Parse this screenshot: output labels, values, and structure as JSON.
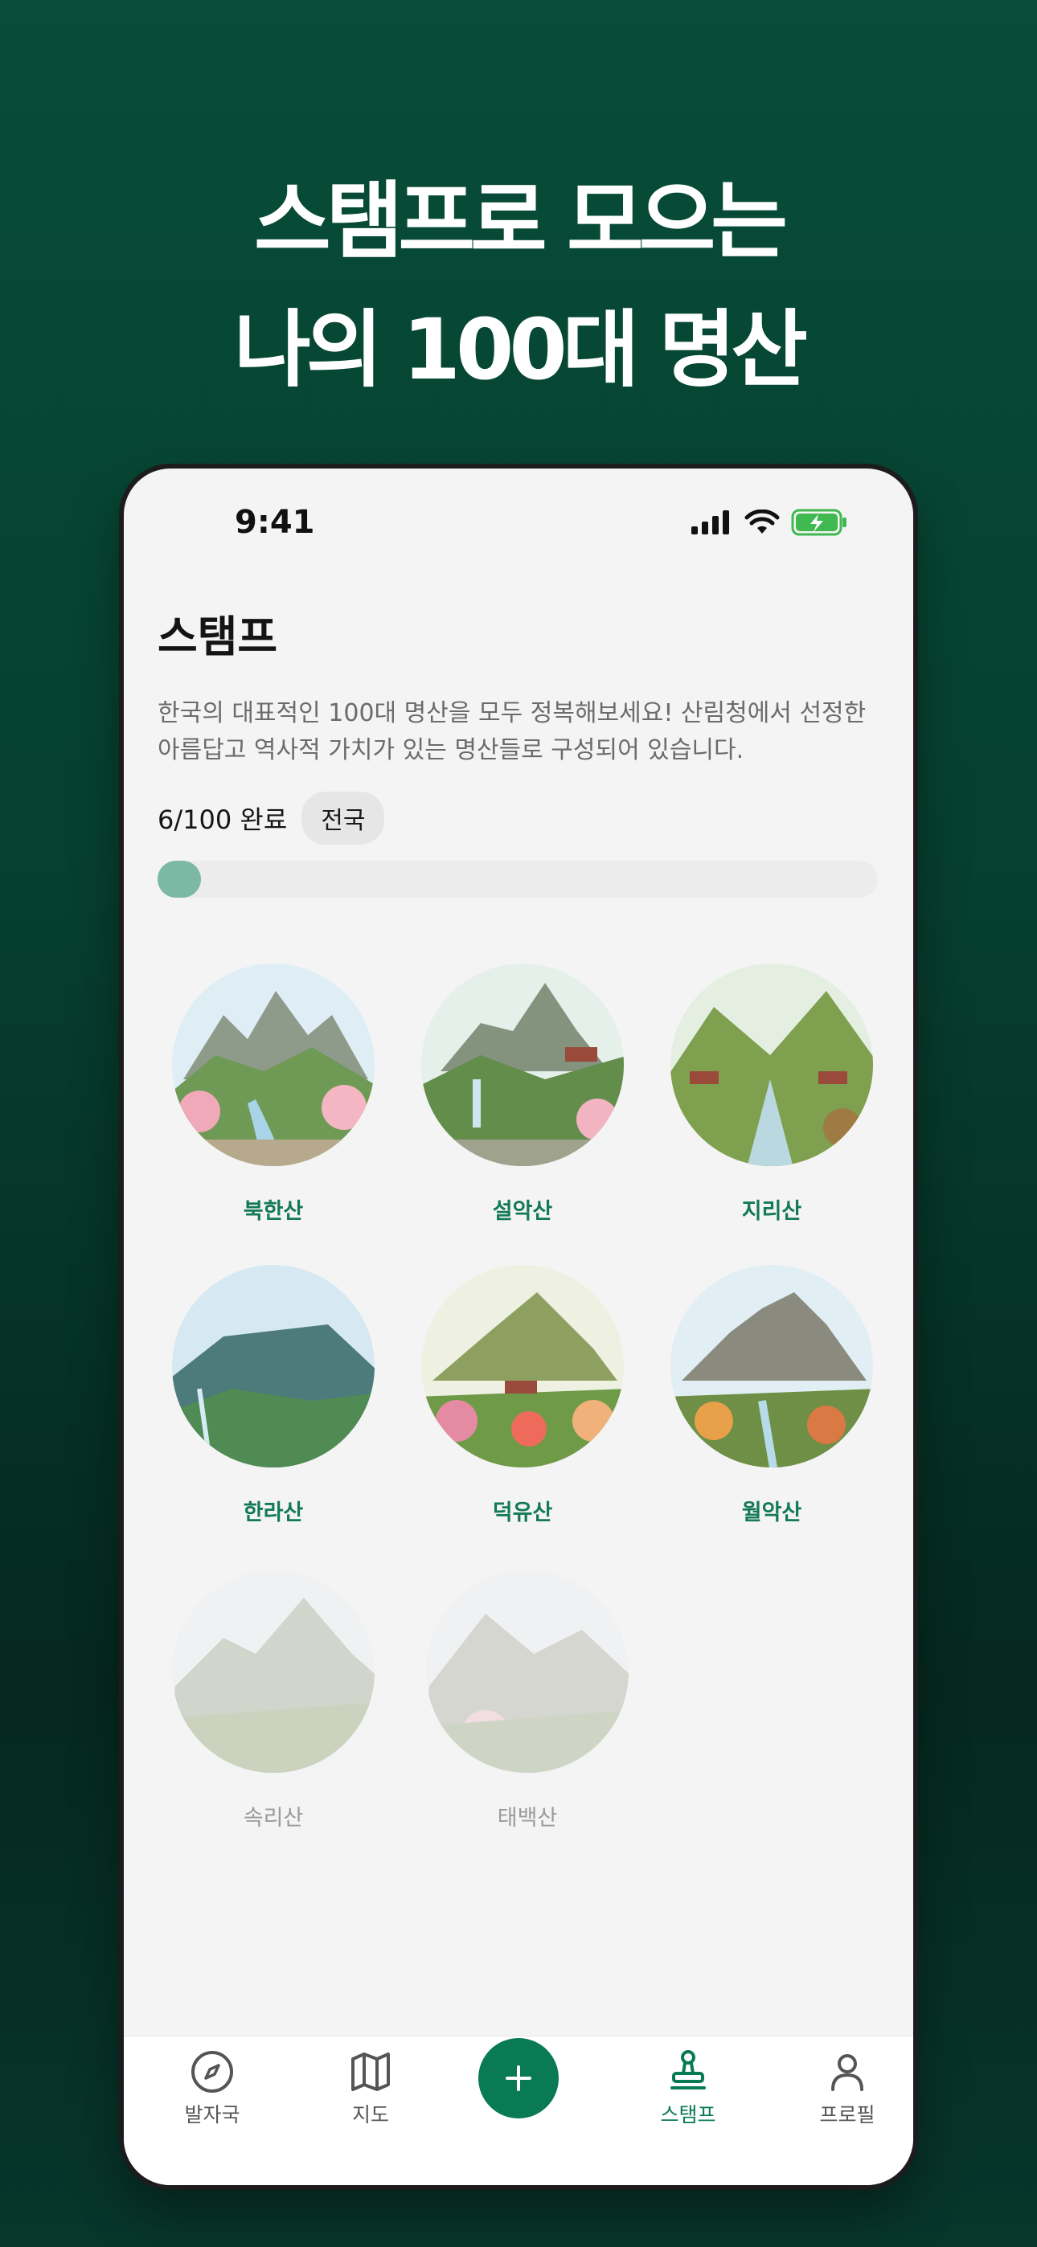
{
  "headline": {
    "line1": "스탬프로 모으는",
    "line2": "나의 100대 명산"
  },
  "status_bar": {
    "time": "9:41",
    "icons": [
      "signal-icon",
      "wifi-icon",
      "battery-charging-icon"
    ]
  },
  "page": {
    "title": "스탬프",
    "description": "한국의 대표적인 100대 명산을 모두 정복해보세요! 산림청에서 선정한 아름답고 역사적 가치가 있는 명산들로 구성되어 있습니다.",
    "progress_text": "6/100 완료",
    "region_filter": "전국",
    "progress_fraction": 0.06
  },
  "stamps": [
    {
      "name": "북한산",
      "collected": true
    },
    {
      "name": "설악산",
      "collected": true
    },
    {
      "name": "지리산",
      "collected": true
    },
    {
      "name": "한라산",
      "collected": true
    },
    {
      "name": "덕유산",
      "collected": true
    },
    {
      "name": "월악산",
      "collected": true
    },
    {
      "name": "속리산",
      "collected": false
    },
    {
      "name": "태백산",
      "collected": false
    }
  ],
  "tab_bar": {
    "tabs": [
      {
        "label": "발자국",
        "icon": "compass-icon",
        "active": false
      },
      {
        "label": "지도",
        "icon": "map-icon",
        "active": false
      },
      {
        "label": "",
        "icon": "plus-icon",
        "active": false
      },
      {
        "label": "스탬프",
        "icon": "stamp-icon",
        "active": true
      },
      {
        "label": "프로필",
        "icon": "person-icon",
        "active": false
      }
    ]
  },
  "colors": {
    "brand_green": "#0a7a55",
    "background_dark": "#063f2f",
    "progress_fill": "#7cb9a4"
  }
}
